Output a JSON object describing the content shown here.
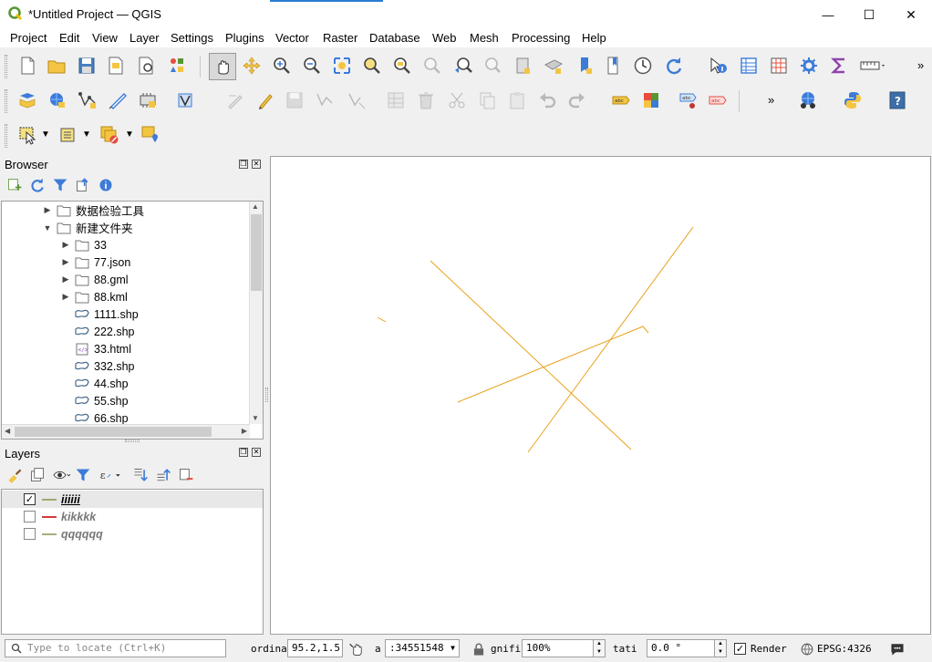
{
  "window": {
    "title": "*Untitled Project — QGIS",
    "minimize_glyph": "—",
    "maximize_glyph": "☐",
    "close_glyph": "✕"
  },
  "menu": {
    "items": [
      "Project",
      "Edit",
      "View",
      "Layer",
      "Settings",
      "Plugins",
      "Vector",
      "Raster",
      "Database",
      "Web",
      "Mesh",
      "Processing",
      "Help"
    ]
  },
  "toolbars": {
    "more_glyph": "»",
    "row1_icons": [
      "new-project-icon",
      "open-project-icon",
      "save-project-icon",
      "new-print-layout-icon",
      "layout-manager-icon",
      "style-manager-icon",
      "pan-map-icon",
      "pan-to-selection-icon",
      "zoom-in-icon",
      "zoom-out-icon",
      "zoom-full-icon",
      "zoom-to-selection-icon",
      "zoom-to-layer-icon",
      "zoom-native-icon",
      "zoom-last-icon",
      "zoom-next-icon",
      "new-bookmark-icon",
      "show-bookmarks-icon",
      "new-map-view-icon",
      "temporal-controller-icon",
      "refresh-icon",
      "identify-features-icon",
      "attribute-table-icon",
      "field-calculator-icon",
      "processing-toolbox-icon",
      "statistical-summary-icon",
      "measure-icon"
    ],
    "row2_icons": [
      "data-source-manager-icon",
      "new-geopackage-icon",
      "new-shapefile-icon",
      "digitize-icon",
      "new-virtual-layer-icon",
      "create-layer-icon",
      "current-edits-icon",
      "toggle-editing-icon",
      "save-edits-icon",
      "add-feature-icon",
      "vertex-tool-icon",
      "modify-attributes-icon",
      "delete-selected-icon",
      "cut-features-icon",
      "copy-features-icon",
      "paste-features-icon",
      "undo-icon",
      "redo-icon",
      "label-icon",
      "diagram-icon",
      "pin-label-icon",
      "show-hide-labels-icon",
      "python-console-icon",
      "help-icon",
      "web-icon"
    ],
    "row3_icons": [
      "select-features-icon",
      "select-by-value-icon",
      "deselect-all-icon",
      "select-location-icon"
    ]
  },
  "browser": {
    "title": "Browser",
    "items": [
      {
        "label": "数据检验工具",
        "type": "folder",
        "expand": "collapsed",
        "indent": 0
      },
      {
        "label": "新建文件夹",
        "type": "folder",
        "expand": "expanded",
        "indent": 0
      },
      {
        "label": "33",
        "type": "folder",
        "expand": "collapsed",
        "indent": 1
      },
      {
        "label": "77.json",
        "type": "folder",
        "expand": "collapsed",
        "indent": 1
      },
      {
        "label": "88.gml",
        "type": "folder",
        "expand": "collapsed",
        "indent": 1
      },
      {
        "label": "88.kml",
        "type": "folder",
        "expand": "collapsed",
        "indent": 1
      },
      {
        "label": "1111.shp",
        "type": "shp",
        "expand": "none",
        "indent": 1
      },
      {
        "label": "222.shp",
        "type": "shp",
        "expand": "none",
        "indent": 1
      },
      {
        "label": "33.html",
        "type": "html",
        "expand": "none",
        "indent": 1
      },
      {
        "label": "332.shp",
        "type": "shp",
        "expand": "none",
        "indent": 1
      },
      {
        "label": "44.shp",
        "type": "shp",
        "expand": "none",
        "indent": 1
      },
      {
        "label": "55.shp",
        "type": "shp",
        "expand": "none",
        "indent": 1
      },
      {
        "label": "66.shp",
        "type": "shp",
        "expand": "none",
        "indent": 1
      }
    ]
  },
  "layers": {
    "title": "Layers",
    "items": [
      {
        "name": "iiiiii",
        "checked": true,
        "color": "#a3a86d"
      },
      {
        "name": "kikkkk",
        "checked": false,
        "color": "#d23a3a"
      },
      {
        "name": "qqqqqq",
        "checked": false,
        "color": "#a3b07a"
      }
    ]
  },
  "map": {
    "line_color": "#e8a21c"
  },
  "status": {
    "locator_placeholder": "Type to locate (Ctrl+K)",
    "coordinate_label": "ordina",
    "coordinate_value": "95.2,1.5",
    "scale_label": "a",
    "scale_value": ":34551548",
    "magnifier_label": "gnifi",
    "magnifier_value": "100%",
    "rotation_label": "tati",
    "rotation_value": "0.0 °",
    "render_label": "Render",
    "render_checked": true,
    "crs_label": "EPSG:4326"
  }
}
